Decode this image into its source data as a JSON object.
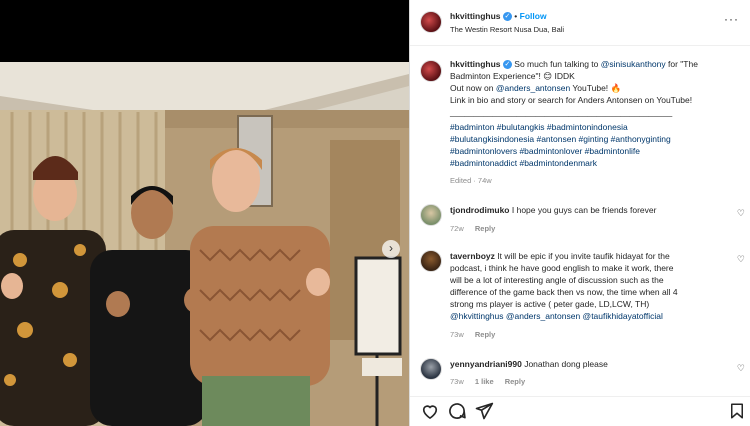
{
  "header": {
    "username": "hkvittinghus",
    "separator": "•",
    "follow_label": "Follow",
    "location": "The Westin Resort Nusa Dua, Bali",
    "more_label": "···"
  },
  "caption": {
    "username": "hkvittinghus",
    "line1_a": "So much fun talking to",
    "mention1": "@sinisukanthony",
    "line1_b": "for \"The",
    "line2": "Badminton Experience\"! 😊 IDDK",
    "line3_a": "Out now on",
    "mention2": "@anders_antonsen",
    "line3_b": "YouTube! 🔥",
    "line4": "Link in bio and story or search for Anders Antonsen on YouTube!",
    "line5": "_______________________________________________",
    "hashtags": [
      "#badminton #bulutangkis #badmintonindonesia",
      "#bulutangkisindonesia #antonsen #ginting #anthonyginting",
      "#badmintonlovers #badmintonlover #badmintonlife",
      "#badmintonaddict #badmintondenmark"
    ],
    "edited": "Edited · 74w"
  },
  "comments": [
    {
      "username": "tjondrodimuko",
      "lines": [
        "I hope you guys can be friends forever"
      ],
      "time": "72w",
      "likes": "",
      "reply": "Reply"
    },
    {
      "username": "tavernboyz",
      "lines": [
        "It will be epic if you invite taufik hidayat for the",
        "podcast, i think he have good english to make it work, there",
        "will be a lot of interesting angle of discussion such as the",
        "difference of the game back then vs now, the time when all 4",
        "strong ms player is active ( peter gade, LD,LCW, TH)",
        "@hkvittinghus @anders_antonsen @taufikhidayatofficial"
      ],
      "time": "73w",
      "likes": "",
      "reply": "Reply"
    },
    {
      "username": "yennyandriani990",
      "lines": [
        "Jonathan dong please"
      ],
      "time": "73w",
      "likes": "1 like",
      "reply": "Reply"
    }
  ],
  "icons": {
    "like": "heart-icon",
    "comment": "comment-icon",
    "share": "share-icon",
    "save": "bookmark-icon",
    "next": "chevron-right-icon"
  },
  "colors": {
    "link": "#00376b",
    "follow": "#0095f6",
    "verified": "#3797f0",
    "muted": "#8e8e8e"
  }
}
